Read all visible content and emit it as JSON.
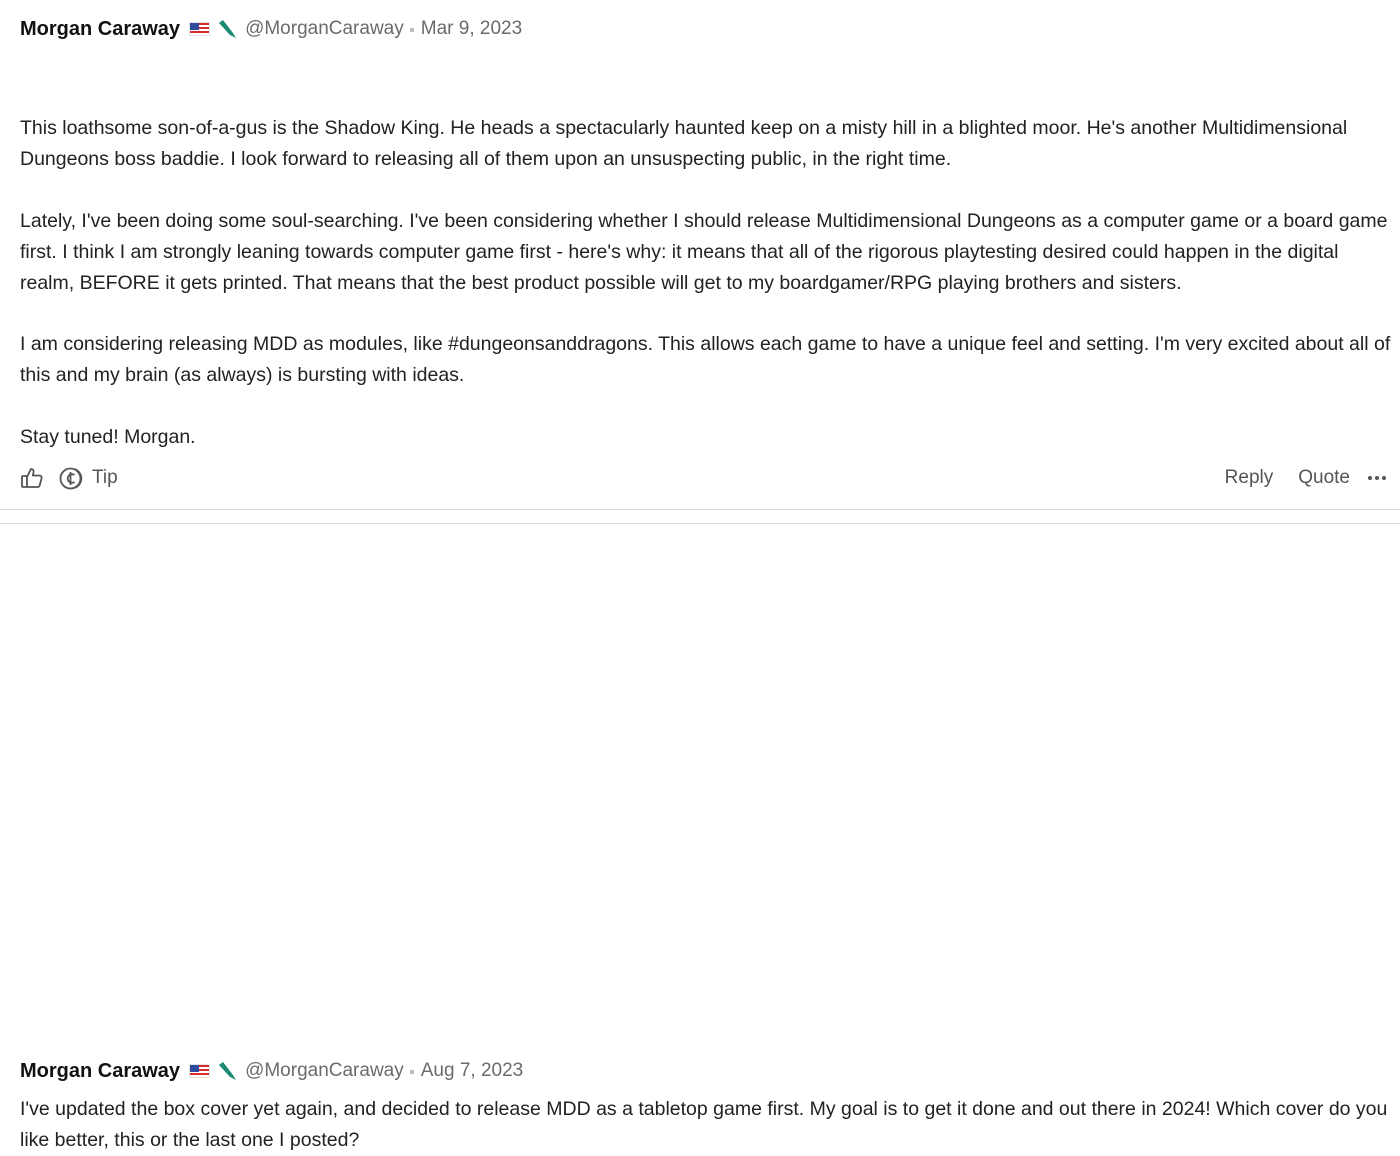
{
  "posts": [
    {
      "author": "Morgan Caraway",
      "handle": "@MorganCaraway",
      "date": "Mar 9, 2023",
      "paragraphs": [
        "This loathsome son-of-a-gus is the Shadow King. He heads a spectacularly haunted keep on a misty hill in a blighted moor. He's another Multidimensional Dungeons boss baddie. I look forward to releasing all of them upon an unsuspecting public, in the right time.",
        "Lately, I've been doing some soul-searching. I've been considering whether I should release Multidimensional Dungeons as a computer game or a board game first. I think I am strongly leaning towards computer game first - here's why: it means that all of the rigorous playtesting desired could happen in the digital realm, BEFORE it gets printed. That means that the best product possible will get to my boardgamer/RPG playing brothers and sisters.",
        "I am considering releasing MDD as modules, like #dungeonsanddragons. This allows each game to have a unique feel and setting. I'm very excited about all of this and my brain (as always) is bursting with ideas.",
        "Stay tuned! Morgan."
      ],
      "actions": {
        "tip": "Tip",
        "reply": "Reply",
        "quote": "Quote"
      }
    },
    {
      "author": "Morgan Caraway",
      "handle": "@MorganCaraway",
      "date": "Aug 7, 2023",
      "paragraphs": [
        "I've updated the box cover yet again, and decided to release MDD as a tabletop game first. My goal is to get it done and out there in 2024! Which cover do you like better, this or the last one I posted?"
      ]
    }
  ],
  "icons": {
    "flag": "us-flag-icon",
    "badge": "brush-badge-icon",
    "like": "thumbs-up-icon",
    "tip": "tip-coin-icon",
    "more": "more-dots-icon"
  },
  "colors": {
    "badge": "#1a8a72",
    "text": "#222222",
    "meta": "#6b6b6b"
  }
}
